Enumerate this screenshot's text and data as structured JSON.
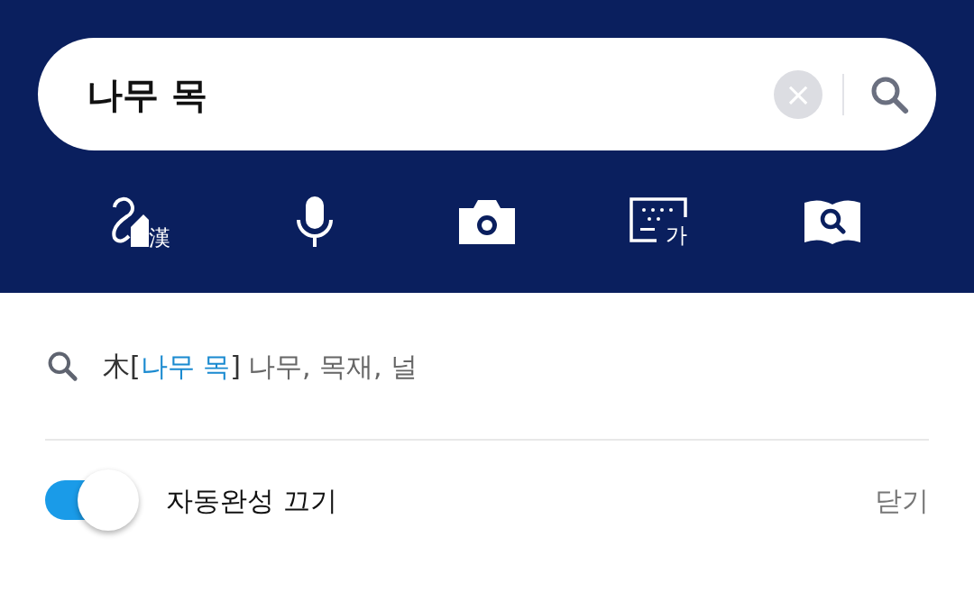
{
  "search": {
    "value": "나무 목",
    "clear_label": "×"
  },
  "tools": [
    {
      "kind": "hanja-writing",
      "label": "漢"
    },
    {
      "kind": "mic"
    },
    {
      "kind": "camera"
    },
    {
      "kind": "keyboard",
      "label": "가"
    },
    {
      "kind": "dictionary"
    }
  ],
  "suggestion": {
    "hanja": "木",
    "open": "[",
    "reading": "나무 목",
    "close": "]",
    "meaning": "나무, 목재, 널"
  },
  "autocomplete_toggle": {
    "label": "자동완성 끄기",
    "on": true
  },
  "close_label": "닫기"
}
